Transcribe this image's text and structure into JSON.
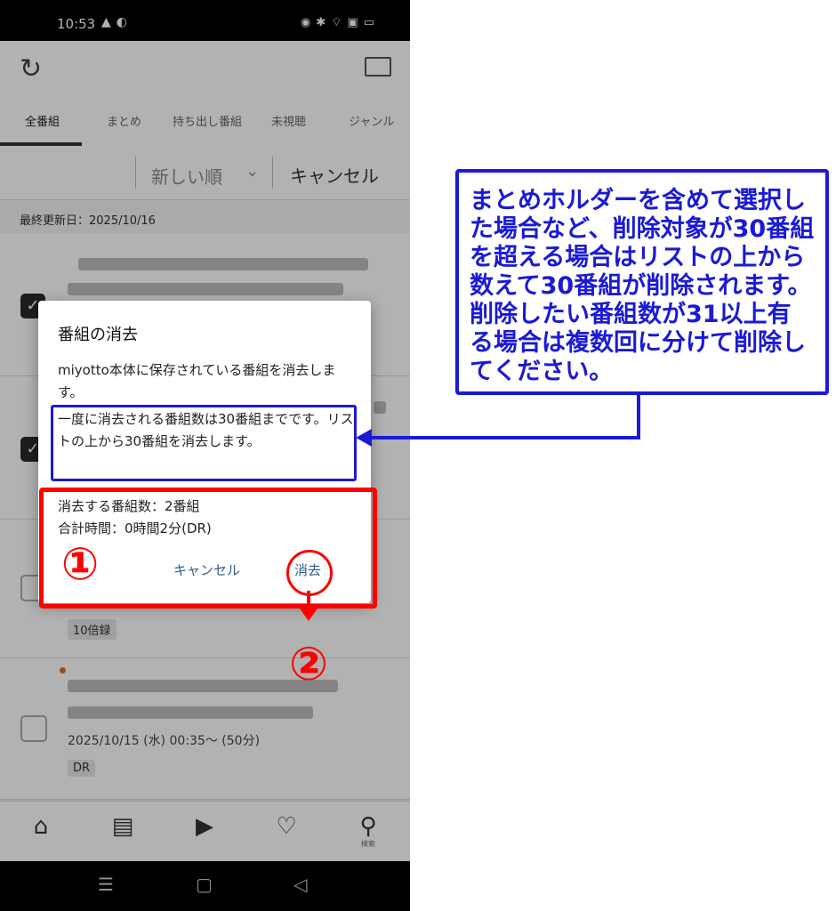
{
  "status_bar": {
    "time": "10:53"
  },
  "tabs": [
    "全番組",
    "まとめ",
    "持ち出し番組",
    "未視聴",
    "ジャンル"
  ],
  "sort": {
    "label": "新しい順",
    "cancel": "キャンセル"
  },
  "last_updated": "最終更新日：2025/10/16",
  "list": {
    "badge_10x": "10倍録",
    "item4_date": "2025/10/15 (水) 00:35〜 (50分)",
    "item4_badge": "DR"
  },
  "bottom_nav": {
    "search_label": "検索"
  },
  "dialog": {
    "title": "番組の消去",
    "message1": "miyotto本体に保存されている番組を消去します。",
    "message2": "一度に消去される番組数は30番組までです。リストの上から30番組を消去します。",
    "count": "消去する番組数：2番組",
    "total_time": "合計時間：0時間2分(DR)",
    "cancel_label": "キャンセル",
    "delete_label": "消去"
  },
  "annotations": {
    "marker1": "①",
    "marker2": "②",
    "callout": "まとめホルダーを含めて選択した場合など、削除対象が30番組を超える場合はリストの上から数えて30番組が削除されます。削除したい番組数が31以上有る場合は複数回に分けて削除してください。",
    "colors": {
      "blue": "#1a1ad6",
      "red": "#ff0000"
    }
  }
}
